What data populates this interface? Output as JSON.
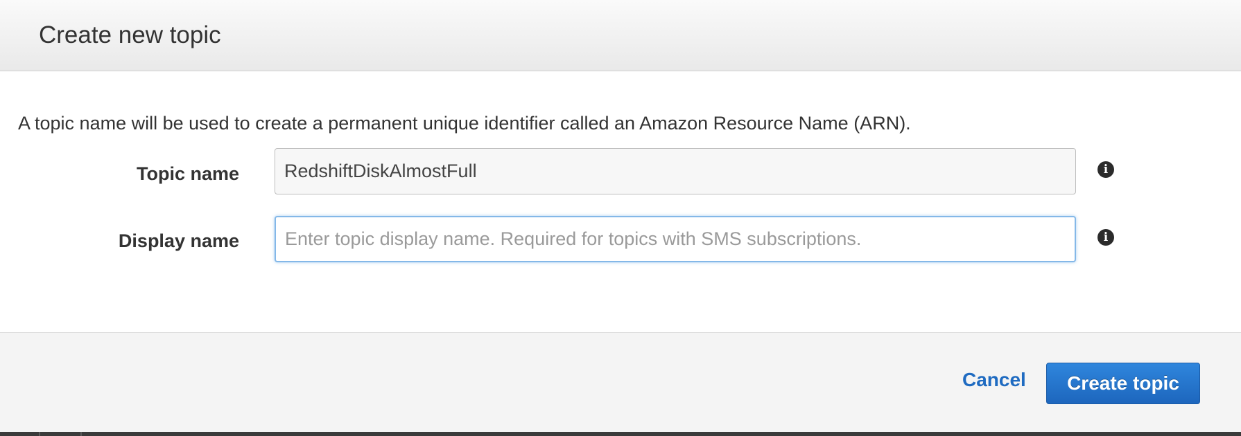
{
  "dialog": {
    "title": "Create new topic",
    "intro": "A topic name will be used to create a permanent unique identifier called an Amazon Resource Name (ARN)."
  },
  "fields": {
    "topic_name": {
      "label": "Topic name",
      "value": "RedshiftDiskAlmostFull",
      "placeholder": "",
      "info_icon": "info-icon"
    },
    "display_name": {
      "label": "Display name",
      "value": "",
      "placeholder": "Enter topic display name. Required for topics with SMS subscriptions.",
      "info_icon": "info-icon"
    }
  },
  "footer": {
    "cancel_label": "Cancel",
    "create_label": "Create topic"
  },
  "colors": {
    "link": "#1f6bc1",
    "primary_button": "#1d66bd",
    "focus_border": "#84b8e8"
  }
}
